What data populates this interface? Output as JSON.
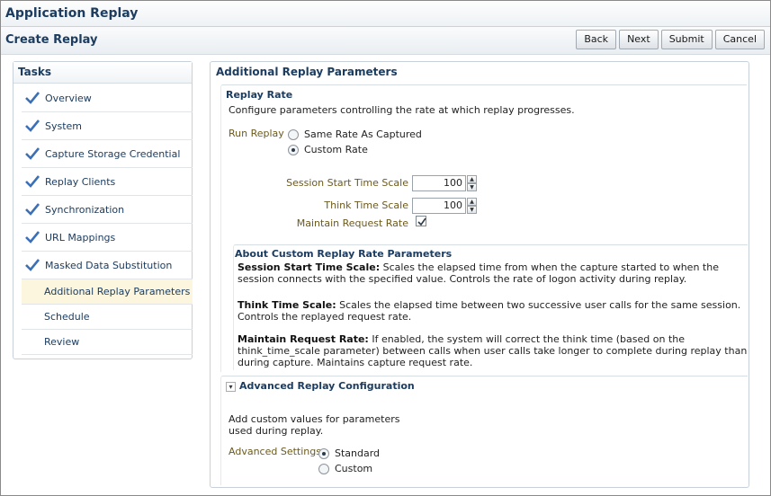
{
  "app": {
    "title": "Application Replay"
  },
  "page": {
    "title": "Create Replay",
    "buttons": {
      "back": "Back",
      "next": "Next",
      "submit": "Submit",
      "cancel": "Cancel"
    }
  },
  "tasks": {
    "title": "Tasks",
    "items": [
      {
        "label": "Overview",
        "done": true
      },
      {
        "label": "System",
        "done": true
      },
      {
        "label": "Capture Storage Credential",
        "done": true
      },
      {
        "label": "Replay Clients",
        "done": true
      },
      {
        "label": "Synchronization",
        "done": true
      },
      {
        "label": "URL Mappings",
        "done": true
      },
      {
        "label": "Masked Data Substitution",
        "done": true
      },
      {
        "label": "Additional Replay Parameters",
        "done": false,
        "active": true
      },
      {
        "label": "Schedule",
        "done": false
      },
      {
        "label": "Review",
        "done": false
      }
    ]
  },
  "main": {
    "title": "Additional Replay Parameters",
    "replay_rate": {
      "title": "Replay Rate",
      "description": "Configure parameters controlling the rate at which replay progresses.",
      "run_replay_label": "Run Replay",
      "options": [
        "Same Rate As Captured",
        "Custom Rate"
      ],
      "selected": "Custom Rate",
      "session_start_label": "Session Start Time Scale",
      "session_start_value": "100",
      "think_time_label": "Think Time Scale",
      "think_time_value": "100",
      "maintain_rate_label": "Maintain Request Rate",
      "maintain_rate_checked": true
    },
    "about": {
      "title": "About Custom Replay Rate Parameters",
      "p1_term": "Session Start Time Scale:",
      "p1_text": " Scales the elapsed time from when the capture started to when the session connects with the specified value. Controls the rate of logon activity during replay.",
      "p2_term": "Think Time Scale:",
      "p2_text": " Scales the elapsed time between two successive user calls for the same session. Controls the replayed request rate.",
      "p3_term": "Maintain Request Rate:",
      "p3_text": " If enabled, the system will correct the think time (based on the think_time_scale parameter) between calls when user calls take longer to complete during replay than during capture. Maintains capture request rate."
    },
    "advanced": {
      "title": "Advanced Replay Configuration",
      "description_line1": "Add custom values for parameters",
      "description_line2": "used during replay.",
      "settings_label": "Advanced Settings",
      "options": [
        "Standard",
        "Custom"
      ],
      "selected": "Standard"
    }
  },
  "colors": {
    "heading": "#1c3c60",
    "field_label": "#6b5a1e",
    "active_task_bg": "#fbf6dd",
    "check": "#3b6fb6"
  }
}
